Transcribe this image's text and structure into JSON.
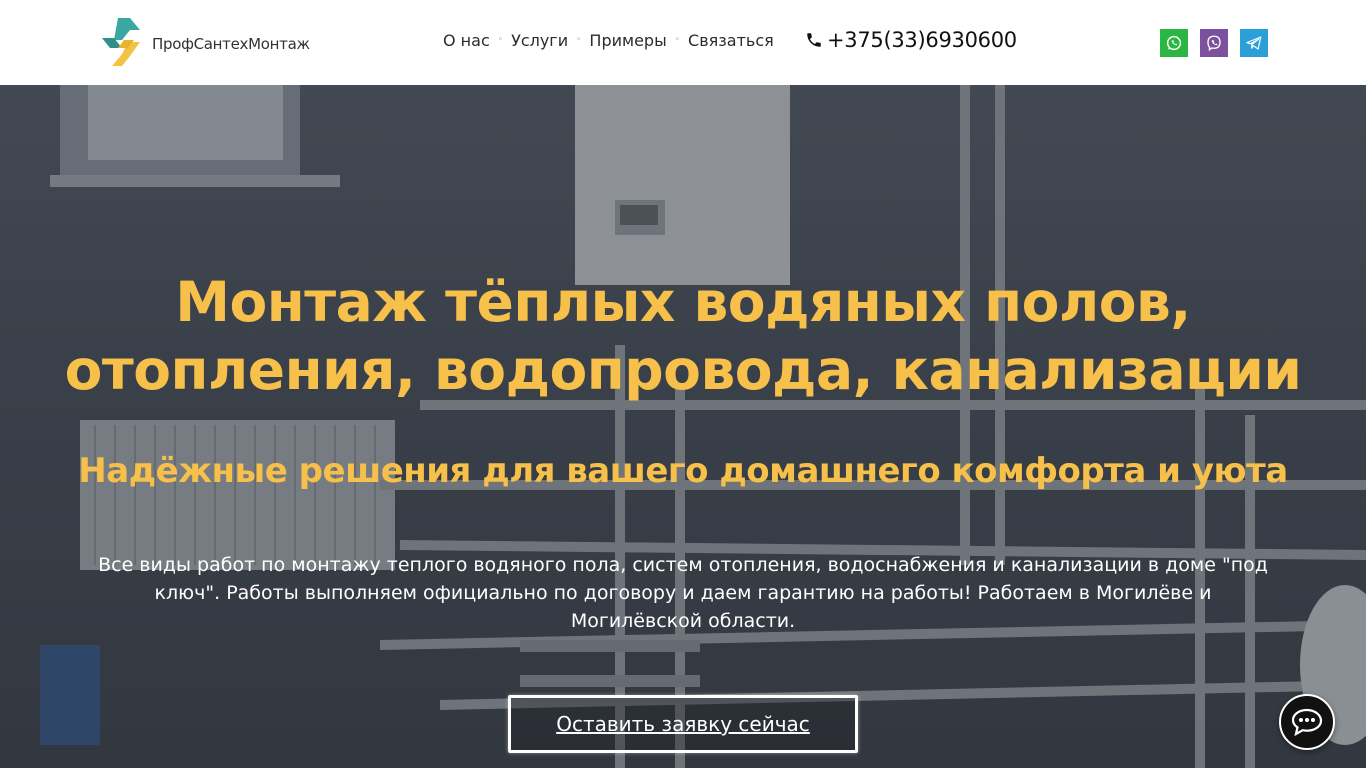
{
  "header": {
    "logo_text": "ПрофСантехМонтаж",
    "nav": [
      {
        "label": "О нас"
      },
      {
        "label": "Услуги"
      },
      {
        "label": "Примеры"
      },
      {
        "label": "Связаться"
      }
    ],
    "phone": "+375(33)6930600",
    "social": [
      "whatsapp-icon",
      "viber-icon",
      "telegram-icon"
    ]
  },
  "hero": {
    "title_line1": "Монтаж тёплых водяных полов,",
    "title_line2": "отопления, водопровода, канализации",
    "subtitle": "Надёжные решения для вашего домашнего комфорта и уюта",
    "description": "Все виды работ по монтажу теплого водяного пола, систем отопления, водоснабжения и канализации в доме \"под ключ\". Работы выполняем официально по договору и даем гарантию на работы! Работаем в Могилёве и Могилёвской области.",
    "cta_label": "Оставить заявку сейчас"
  },
  "colors": {
    "accent": "#f6c04a",
    "whatsapp": "#2cb742",
    "viber": "#7b519d",
    "telegram": "#2a9fd8"
  }
}
